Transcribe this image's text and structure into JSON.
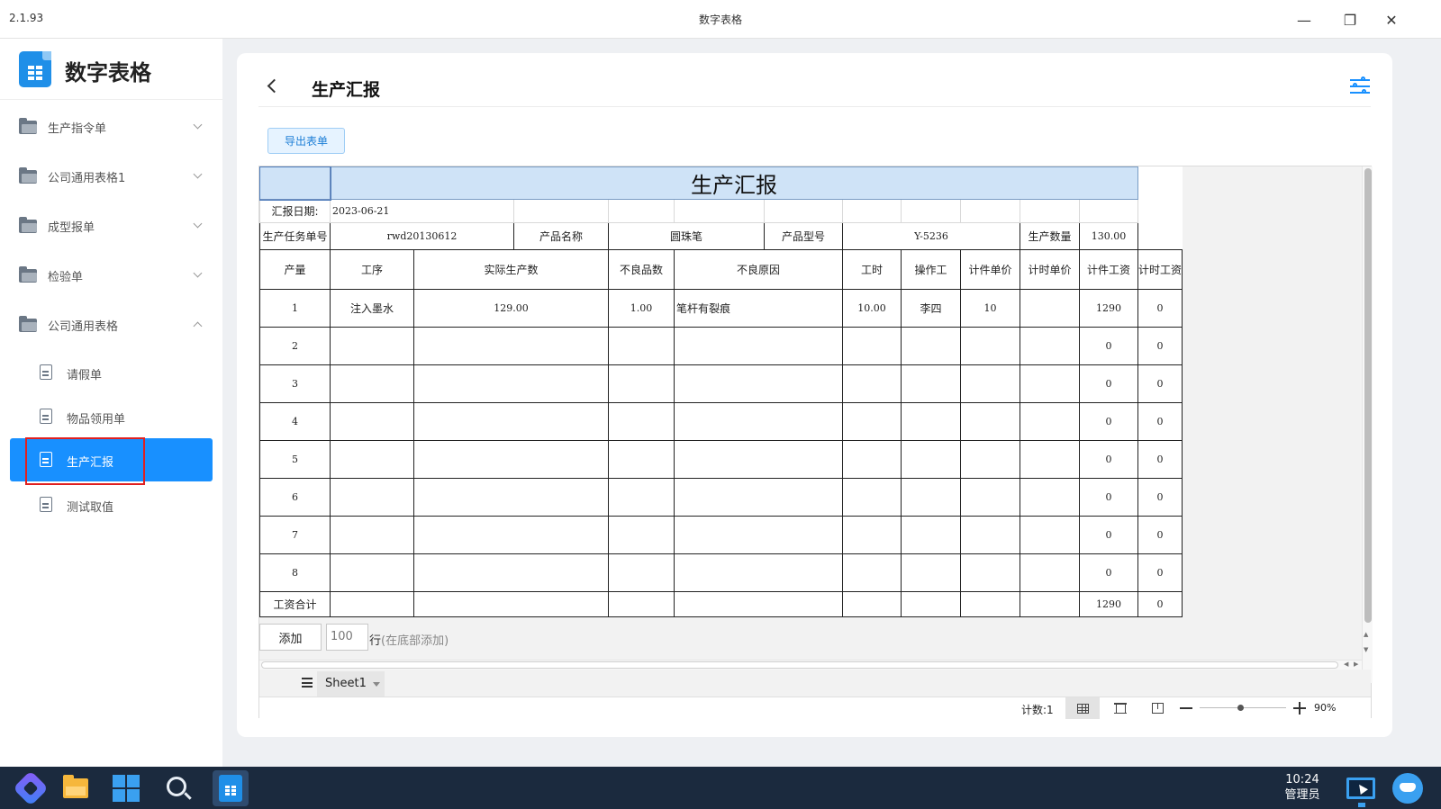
{
  "window": {
    "version": "2.1.93",
    "title": "数字表格",
    "minimize_glyph": "—",
    "restore_glyph": "❐",
    "close_glyph": "✕"
  },
  "sidebar": {
    "brand": "数字表格",
    "groups": [
      {
        "label": "生产指令单",
        "expanded": false
      },
      {
        "label": "公司通用表格1",
        "expanded": false
      },
      {
        "label": "成型报单",
        "expanded": false
      },
      {
        "label": "检验单",
        "expanded": false
      },
      {
        "label": "公司通用表格",
        "expanded": true
      }
    ],
    "items": [
      {
        "label": "请假单",
        "active": false
      },
      {
        "label": "物品领用单",
        "active": false
      },
      {
        "label": "生产汇报",
        "active": true
      },
      {
        "label": "测试取值",
        "active": false
      }
    ]
  },
  "main": {
    "title": "生产汇报",
    "export_label": "导出表单"
  },
  "sheet": {
    "title": "生产汇报",
    "report_date_label": "汇报日期:",
    "report_date": "2023-06-21",
    "task_no_label": "生产任务单号",
    "task_no": "rwd20130612",
    "product_name_label": "产品名称",
    "product_name": "圆珠笔",
    "product_model_label": "产品型号",
    "product_model": "Y-5236",
    "quantity_label": "生产数量",
    "quantity": "130.00",
    "headers": [
      "产量",
      "工序",
      "实际生产数",
      "不良品数",
      "不良原因",
      "工时",
      "操作工",
      "计件单价",
      "计时单价",
      "计件工资",
      "计时工资"
    ],
    "rows": [
      [
        "1",
        "注入墨水",
        "129.00",
        "1.00",
        "笔杆有裂痕",
        "10.00",
        "李四",
        "10",
        "",
        "1290",
        "0"
      ],
      [
        "2",
        "",
        "",
        "",
        "",
        "",
        "",
        "",
        "",
        "0",
        "0"
      ],
      [
        "3",
        "",
        "",
        "",
        "",
        "",
        "",
        "",
        "",
        "0",
        "0"
      ],
      [
        "4",
        "",
        "",
        "",
        "",
        "",
        "",
        "",
        "",
        "0",
        "0"
      ],
      [
        "5",
        "",
        "",
        "",
        "",
        "",
        "",
        "",
        "",
        "0",
        "0"
      ],
      [
        "6",
        "",
        "",
        "",
        "",
        "",
        "",
        "",
        "",
        "0",
        "0"
      ],
      [
        "7",
        "",
        "",
        "",
        "",
        "",
        "",
        "",
        "",
        "0",
        "0"
      ],
      [
        "8",
        "",
        "",
        "",
        "",
        "",
        "",
        "",
        "",
        "0",
        "0"
      ]
    ],
    "total_label": "工资合计",
    "total_piece": "1290",
    "total_time": "0",
    "add_label": "添加",
    "add_count": "100",
    "add_suffix": "行",
    "add_hint": "(在底部添加)",
    "tab_name": "Sheet1",
    "status_count": "计数:1",
    "zoom": "90%"
  },
  "taskbar": {
    "time": "10:24",
    "user": "管理员"
  }
}
